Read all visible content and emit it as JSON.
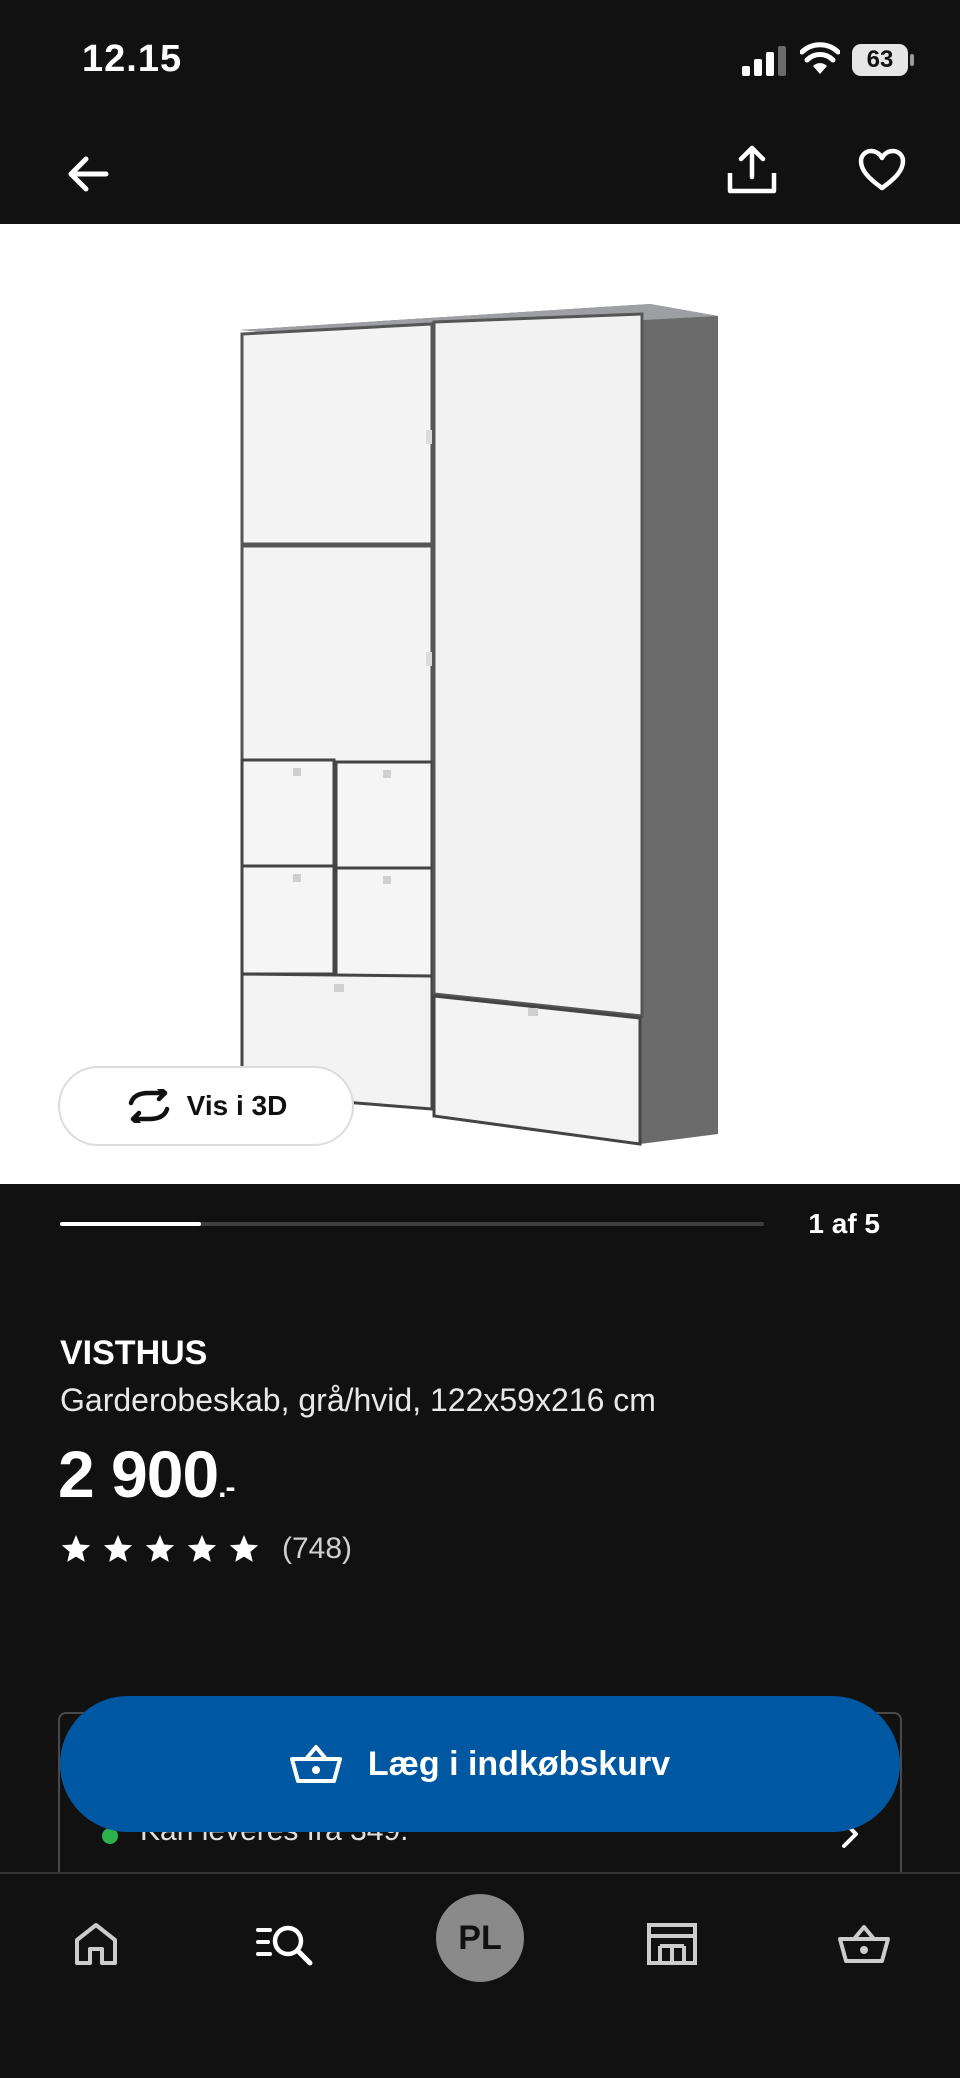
{
  "status_bar": {
    "time": "12.15",
    "battery": "63"
  },
  "product": {
    "brand": "VISTHUS",
    "description": "Garderobeskab, grå/hvid, 122x59x216 cm",
    "price_main": "2 900",
    "price_suffix": ".-",
    "rating_stars": 5,
    "review_count": "(748)"
  },
  "gallery": {
    "view_3d_label": "Vis i 3D",
    "counter": "1 af 5",
    "progress_fraction": 0.2
  },
  "availability": {
    "line1": "Kan leveres fra 349."
  },
  "cart": {
    "add_label": "Læg i indkøbskurv"
  },
  "bottom_nav": {
    "avatar_initials": "PL"
  },
  "colors": {
    "accent": "#0058a3",
    "background": "#111111",
    "available": "#2bb24c"
  }
}
